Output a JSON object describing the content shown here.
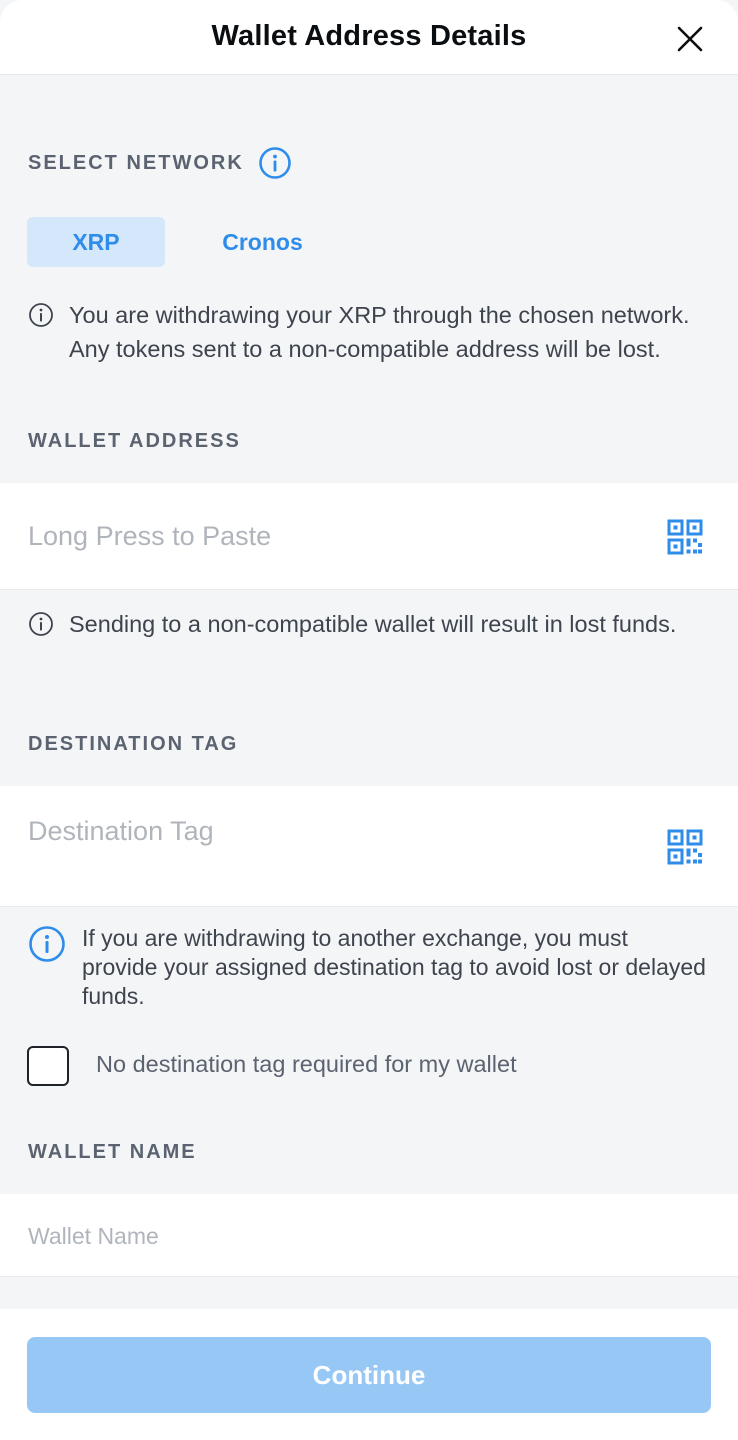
{
  "header": {
    "title": "Wallet Address Details",
    "close_icon": "close-icon"
  },
  "network": {
    "label": "SELECT NETWORK",
    "tabs": [
      {
        "label": "XRP",
        "selected": true
      },
      {
        "label": "Cronos",
        "selected": false
      }
    ],
    "note": "You are withdrawing your XRP through the chosen network. Any tokens sent to a non-compatible address will be lost."
  },
  "wallet_address": {
    "label": "WALLET ADDRESS",
    "placeholder": "Long Press to Paste",
    "value": "",
    "note": "Sending to a non-compatible wallet will result in lost funds."
  },
  "destination_tag": {
    "label": "DESTINATION TAG",
    "placeholder": "Destination Tag",
    "value": "",
    "note": "If you are withdrawing to another exchange, you must provide your assigned destination tag to avoid lost or delayed funds.",
    "checkbox_label": "No destination tag required for my wallet",
    "checkbox_checked": false
  },
  "wallet_name": {
    "label": "WALLET NAME",
    "placeholder": "Wallet Name",
    "value": ""
  },
  "footer": {
    "continue_label": "Continue"
  },
  "colors": {
    "accent": "#2E8CEB",
    "tab_selected_bg": "#D5E7FA",
    "button_disabled_bg": "#97C8F5",
    "background": "#F4F5F7"
  }
}
